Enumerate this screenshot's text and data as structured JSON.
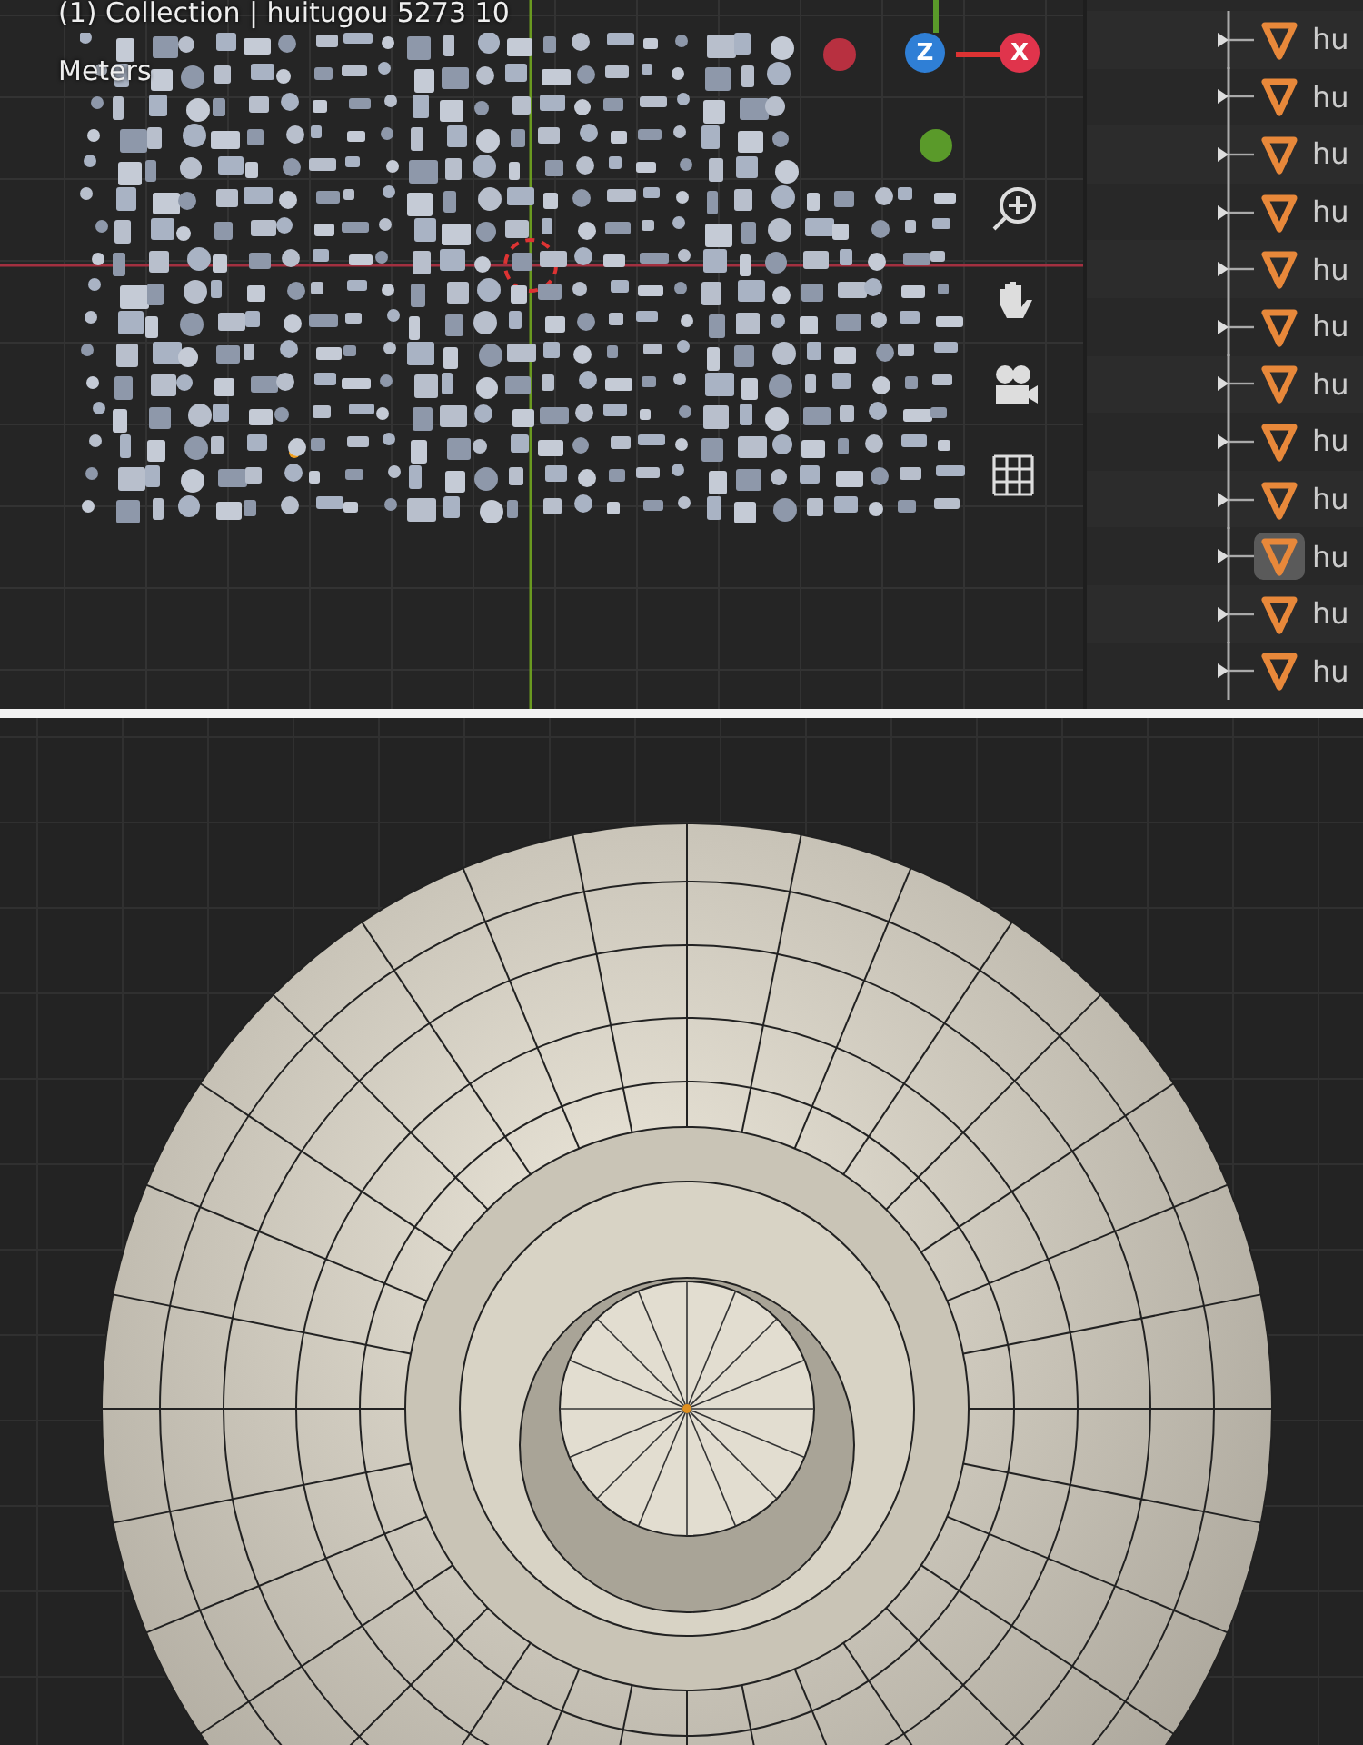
{
  "viewport": {
    "header": "(1) Collection | huitugou 5273 10",
    "units": "Meters",
    "gizmo": [
      {
        "axis": "Z",
        "color": "#2f7fd6"
      },
      {
        "axis": "X",
        "color": "#e0344c"
      }
    ]
  },
  "outliner": {
    "rows": [
      {
        "label": "hu",
        "selected": false
      },
      {
        "label": "hu",
        "selected": false
      },
      {
        "label": "hu",
        "selected": false
      },
      {
        "label": "hu",
        "selected": false
      },
      {
        "label": "hu",
        "selected": false
      },
      {
        "label": "hu",
        "selected": false
      },
      {
        "label": "hu",
        "selected": false
      },
      {
        "label": "hu",
        "selected": false
      },
      {
        "label": "hu",
        "selected": false
      },
      {
        "label": "hu",
        "selected": true
      },
      {
        "label": "hu",
        "selected": false
      },
      {
        "label": "hu",
        "selected": false
      }
    ]
  }
}
